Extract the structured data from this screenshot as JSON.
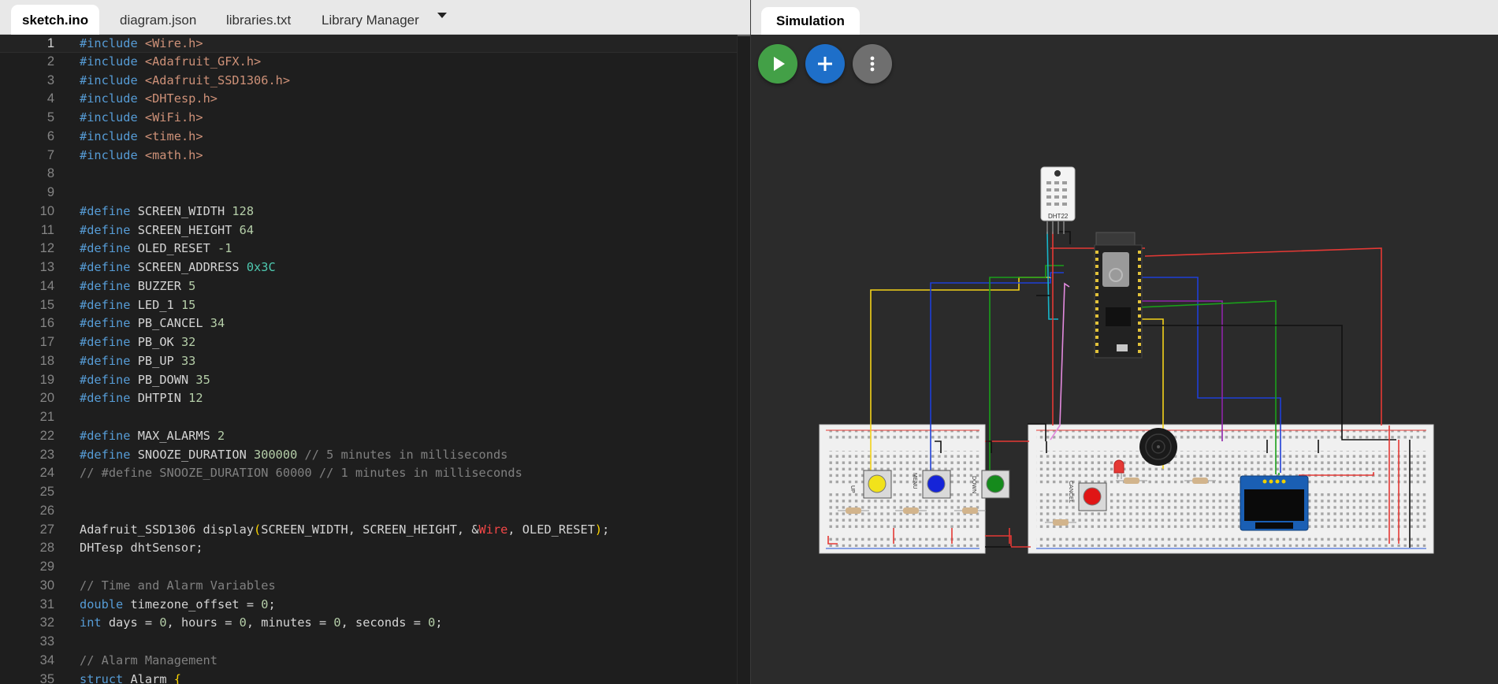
{
  "editor": {
    "tabs": [
      {
        "label": "sketch.ino",
        "active": true
      },
      {
        "label": "diagram.json",
        "active": false
      },
      {
        "label": "libraries.txt",
        "active": false
      },
      {
        "label": "Library Manager",
        "active": false
      }
    ],
    "current_line": 1,
    "lines": [
      {
        "n": "1",
        "tokens": [
          {
            "t": "#include ",
            "c": "kw"
          },
          {
            "t": "<Wire.h>",
            "c": "str"
          }
        ]
      },
      {
        "n": "2",
        "tokens": [
          {
            "t": "#include ",
            "c": "kw"
          },
          {
            "t": "<Adafruit_GFX.h>",
            "c": "str"
          }
        ]
      },
      {
        "n": "3",
        "tokens": [
          {
            "t": "#include ",
            "c": "kw"
          },
          {
            "t": "<Adafruit_SSD1306.h>",
            "c": "str"
          }
        ]
      },
      {
        "n": "4",
        "tokens": [
          {
            "t": "#include ",
            "c": "kw"
          },
          {
            "t": "<DHTesp.h>",
            "c": "str"
          }
        ]
      },
      {
        "n": "5",
        "tokens": [
          {
            "t": "#include ",
            "c": "kw"
          },
          {
            "t": "<WiFi.h>",
            "c": "str"
          }
        ]
      },
      {
        "n": "6",
        "tokens": [
          {
            "t": "#include ",
            "c": "kw"
          },
          {
            "t": "<time.h>",
            "c": "str"
          }
        ]
      },
      {
        "n": "7",
        "tokens": [
          {
            "t": "#include ",
            "c": "kw"
          },
          {
            "t": "<math.h>",
            "c": "str"
          }
        ]
      },
      {
        "n": "8",
        "tokens": []
      },
      {
        "n": "9",
        "tokens": []
      },
      {
        "n": "10",
        "tokens": [
          {
            "t": "#define ",
            "c": "kw"
          },
          {
            "t": "SCREEN_WIDTH ",
            "c": ""
          },
          {
            "t": "128",
            "c": "num"
          }
        ]
      },
      {
        "n": "11",
        "tokens": [
          {
            "t": "#define ",
            "c": "kw"
          },
          {
            "t": "SCREEN_HEIGHT ",
            "c": ""
          },
          {
            "t": "64",
            "c": "num"
          }
        ]
      },
      {
        "n": "12",
        "tokens": [
          {
            "t": "#define ",
            "c": "kw"
          },
          {
            "t": "OLED_RESET ",
            "c": ""
          },
          {
            "t": "-1",
            "c": "num"
          }
        ]
      },
      {
        "n": "13",
        "tokens": [
          {
            "t": "#define ",
            "c": "kw"
          },
          {
            "t": "SCREEN_ADDRESS ",
            "c": ""
          },
          {
            "t": "0x3C",
            "c": "hex"
          }
        ]
      },
      {
        "n": "14",
        "tokens": [
          {
            "t": "#define ",
            "c": "kw"
          },
          {
            "t": "BUZZER ",
            "c": ""
          },
          {
            "t": "5",
            "c": "num"
          }
        ]
      },
      {
        "n": "15",
        "tokens": [
          {
            "t": "#define ",
            "c": "kw"
          },
          {
            "t": "LED_1 ",
            "c": ""
          },
          {
            "t": "15",
            "c": "num"
          }
        ]
      },
      {
        "n": "16",
        "tokens": [
          {
            "t": "#define ",
            "c": "kw"
          },
          {
            "t": "PB_CANCEL ",
            "c": ""
          },
          {
            "t": "34",
            "c": "num"
          }
        ]
      },
      {
        "n": "17",
        "tokens": [
          {
            "t": "#define ",
            "c": "kw"
          },
          {
            "t": "PB_OK ",
            "c": ""
          },
          {
            "t": "32",
            "c": "num"
          }
        ]
      },
      {
        "n": "18",
        "tokens": [
          {
            "t": "#define ",
            "c": "kw"
          },
          {
            "t": "PB_UP ",
            "c": ""
          },
          {
            "t": "33",
            "c": "num"
          }
        ]
      },
      {
        "n": "19",
        "tokens": [
          {
            "t": "#define ",
            "c": "kw"
          },
          {
            "t": "PB_DOWN ",
            "c": ""
          },
          {
            "t": "35",
            "c": "num"
          }
        ]
      },
      {
        "n": "20",
        "tokens": [
          {
            "t": "#define ",
            "c": "kw"
          },
          {
            "t": "DHTPIN ",
            "c": ""
          },
          {
            "t": "12",
            "c": "num"
          }
        ]
      },
      {
        "n": "21",
        "tokens": []
      },
      {
        "n": "22",
        "tokens": [
          {
            "t": "#define ",
            "c": "kw"
          },
          {
            "t": "MAX_ALARMS ",
            "c": ""
          },
          {
            "t": "2",
            "c": "num"
          }
        ]
      },
      {
        "n": "23",
        "tokens": [
          {
            "t": "#define ",
            "c": "kw"
          },
          {
            "t": "SNOOZE_DURATION ",
            "c": ""
          },
          {
            "t": "300000",
            "c": "num"
          },
          {
            "t": " // 5 minutes in milliseconds",
            "c": "cmt"
          }
        ]
      },
      {
        "n": "24",
        "tokens": [
          {
            "t": "// #define SNOOZE_DURATION 60000 // 1 minutes in milliseconds",
            "c": "cmt"
          }
        ]
      },
      {
        "n": "25",
        "tokens": []
      },
      {
        "n": "26",
        "tokens": []
      },
      {
        "n": "27",
        "tokens": [
          {
            "t": "Adafruit_SSD1306 display",
            "c": ""
          },
          {
            "t": "(",
            "c": "br"
          },
          {
            "t": "SCREEN_WIDTH, SCREEN_HEIGHT, &",
            "c": ""
          },
          {
            "t": "Wire",
            "c": "red"
          },
          {
            "t": ", OLED_RESET",
            "c": ""
          },
          {
            "t": ")",
            "c": "br"
          },
          {
            "t": ";",
            "c": ""
          }
        ]
      },
      {
        "n": "28",
        "tokens": [
          {
            "t": "DHTesp dhtSensor;",
            "c": ""
          }
        ]
      },
      {
        "n": "29",
        "tokens": []
      },
      {
        "n": "30",
        "tokens": [
          {
            "t": "// Time and Alarm Variables",
            "c": "cmt"
          }
        ]
      },
      {
        "n": "31",
        "tokens": [
          {
            "t": "double",
            "c": "kw"
          },
          {
            "t": " timezone_offset = ",
            "c": ""
          },
          {
            "t": "0",
            "c": "num"
          },
          {
            "t": ";",
            "c": ""
          }
        ]
      },
      {
        "n": "32",
        "tokens": [
          {
            "t": "int",
            "c": "kw"
          },
          {
            "t": " days = ",
            "c": ""
          },
          {
            "t": "0",
            "c": "num"
          },
          {
            "t": ", hours = ",
            "c": ""
          },
          {
            "t": "0",
            "c": "num"
          },
          {
            "t": ", minutes = ",
            "c": ""
          },
          {
            "t": "0",
            "c": "num"
          },
          {
            "t": ", seconds = ",
            "c": ""
          },
          {
            "t": "0",
            "c": "num"
          },
          {
            "t": ";",
            "c": ""
          }
        ]
      },
      {
        "n": "33",
        "tokens": []
      },
      {
        "n": "34",
        "tokens": [
          {
            "t": "// Alarm Management",
            "c": "cmt"
          }
        ]
      },
      {
        "n": "35",
        "tokens": [
          {
            "t": "struct",
            "c": "kw"
          },
          {
            "t": " Alarm ",
            "c": ""
          },
          {
            "t": "{",
            "c": "br"
          }
        ]
      }
    ]
  },
  "simulation": {
    "tab_label": "Simulation",
    "buttons": [
      {
        "name": "start-simulation-button",
        "icon": "play-icon",
        "color": "#43a047"
      },
      {
        "name": "add-part-button",
        "icon": "plus-icon",
        "color": "#1e6fc9"
      },
      {
        "name": "more-options-button",
        "icon": "kebab-menu-icon",
        "color": "#6f6f6f"
      }
    ],
    "circuit": {
      "sensor_label": "DHT22",
      "mcu_badge": "2",
      "button_labels": [
        "UP",
        "MENU",
        "DOWN",
        "CANCEL"
      ],
      "button_colors": [
        "#f1e21b",
        "#1524d8",
        "#158a1c",
        "#e01515"
      ],
      "breadboard_col_labels": [
        "1",
        "5",
        "10",
        "15",
        "20",
        "25",
        "30",
        "35",
        "40",
        "45",
        "50",
        "55",
        "60"
      ],
      "breadboard_row_labels": [
        "a",
        "b",
        "c",
        "d",
        "e",
        "f",
        "g",
        "h",
        "i",
        "j"
      ]
    }
  }
}
